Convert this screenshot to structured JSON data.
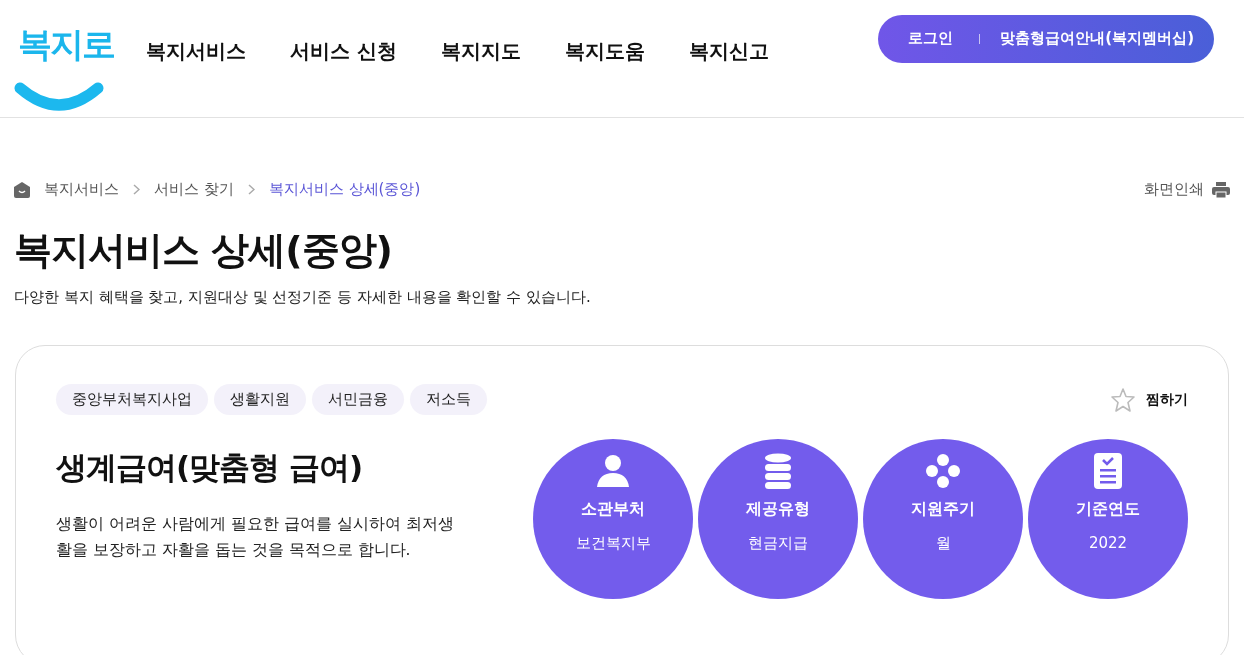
{
  "header": {
    "logo": "복지로",
    "nav": [
      {
        "label": "복지서비스"
      },
      {
        "label": "서비스 신청"
      },
      {
        "label": "복지지도"
      },
      {
        "label": "복지도움"
      },
      {
        "label": "복지신고"
      }
    ],
    "pill": [
      "로그인",
      "맞춤형급여안내(복지멤버십)"
    ]
  },
  "breadcrumb": [
    {
      "label": "복지서비스",
      "current": false
    },
    {
      "label": "서비스 찾기",
      "current": false
    },
    {
      "label": "복지서비스 상세(중앙)",
      "current": true
    }
  ],
  "print_label": "화면인쇄",
  "page_title": "복지서비스 상세(중앙)",
  "page_description": "다양한 복지 혜택을 찾고, 지원대상 및 선정기준 등 자세한 내용을 확인할 수 있습니다.",
  "service": {
    "tags": [
      "중앙부처복지사업",
      "생활지원",
      "서민금융",
      "저소득"
    ],
    "favorite": {
      "label": "찜하기",
      "on": false
    },
    "title": "생계급여(맞춤형 급여)",
    "description": "생활이 어려운 사람에게 필요한 급여를 실시하여 최저생활을 보장하고 자활을 돕는 것을 목적으로 합니다.",
    "facts": [
      {
        "kind": "person",
        "label": "소관부처",
        "value": "보건복지부"
      },
      {
        "kind": "database",
        "label": "제공유형",
        "value": "현금지급"
      },
      {
        "kind": "dots",
        "label": "지원주기",
        "value": "월"
      },
      {
        "kind": "document",
        "label": "기준연도",
        "value": "2022"
      }
    ]
  }
}
